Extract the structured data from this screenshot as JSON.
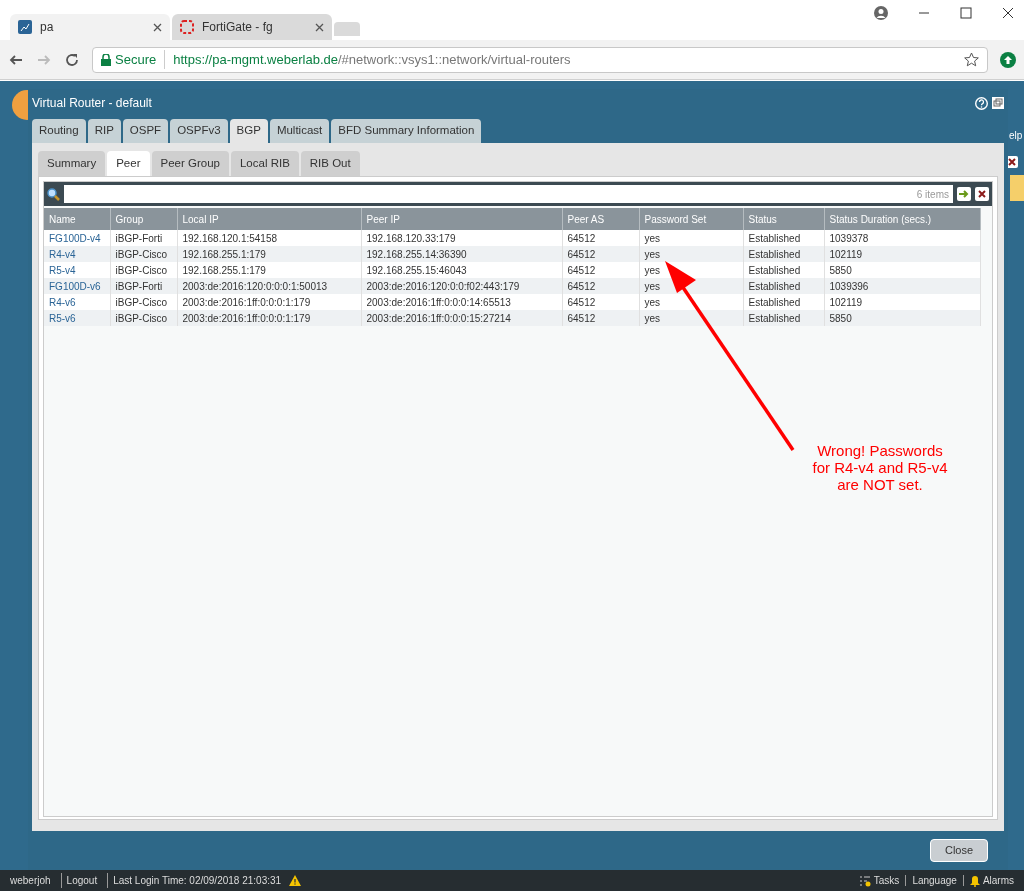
{
  "browser": {
    "tabs": [
      {
        "label": "pa",
        "selected": true
      },
      {
        "label": "FortiGate - fg",
        "selected": false
      }
    ],
    "secure_label": "Secure",
    "url_host": "https://pa-mgmt.weberlab.de",
    "url_path": "/#network::vsys1::network/virtual-routers"
  },
  "background": {
    "help_text": "elp"
  },
  "dialog": {
    "title": "Virtual Router - default",
    "tabs": [
      {
        "label": "Routing",
        "selected": false
      },
      {
        "label": "RIP",
        "selected": false
      },
      {
        "label": "OSPF",
        "selected": false
      },
      {
        "label": "OSPFv3",
        "selected": false
      },
      {
        "label": "BGP",
        "selected": true
      },
      {
        "label": "Multicast",
        "selected": false
      },
      {
        "label": "BFD Summary Information",
        "selected": false
      }
    ],
    "subtabs": [
      {
        "label": "Summary",
        "selected": false
      },
      {
        "label": "Peer",
        "selected": true
      },
      {
        "label": "Peer Group",
        "selected": false
      },
      {
        "label": "Local RIB",
        "selected": false
      },
      {
        "label": "RIB Out",
        "selected": false
      }
    ],
    "item_count": "6 items",
    "table": {
      "columns": [
        "Name",
        "Group",
        "Local IP",
        "Peer IP",
        "Peer AS",
        "Password Set",
        "Status",
        "Status Duration (secs.)"
      ],
      "rows": [
        [
          "FG100D-v4",
          "iBGP-Forti",
          "192.168.120.1:54158",
          "192.168.120.33:179",
          "64512",
          "yes",
          "Established",
          "1039378"
        ],
        [
          "R4-v4",
          "iBGP-Cisco",
          "192.168.255.1:179",
          "192.168.255.14:36390",
          "64512",
          "yes",
          "Established",
          "102119"
        ],
        [
          "R5-v4",
          "iBGP-Cisco",
          "192.168.255.1:179",
          "192.168.255.15:46043",
          "64512",
          "yes",
          "Established",
          "5850"
        ],
        [
          "FG100D-v6",
          "iBGP-Forti",
          "2003:de:2016:120:0:0:0:1:50013",
          "2003:de:2016:120:0:0:f02:443:179",
          "64512",
          "yes",
          "Established",
          "1039396"
        ],
        [
          "R4-v6",
          "iBGP-Cisco",
          "2003:de:2016:1ff:0:0:0:1:179",
          "2003:de:2016:1ff:0:0:0:14:65513",
          "64512",
          "yes",
          "Established",
          "102119"
        ],
        [
          "R5-v6",
          "iBGP-Cisco",
          "2003:de:2016:1ff:0:0:0:1:179",
          "2003:de:2016:1ff:0:0:0:15:27214",
          "64512",
          "yes",
          "Established",
          "5850"
        ]
      ]
    },
    "close_button": "Close"
  },
  "annotation": {
    "lines": [
      "Wrong! Passwords",
      "for R4-v4 and R5-v4",
      "are NOT set."
    ]
  },
  "status_bar": {
    "left": [
      "weberjoh",
      "Logout",
      "Last Login Time: 02/09/2018 21:03:31"
    ],
    "right": [
      "Tasks",
      "Language",
      "Alarms"
    ]
  }
}
